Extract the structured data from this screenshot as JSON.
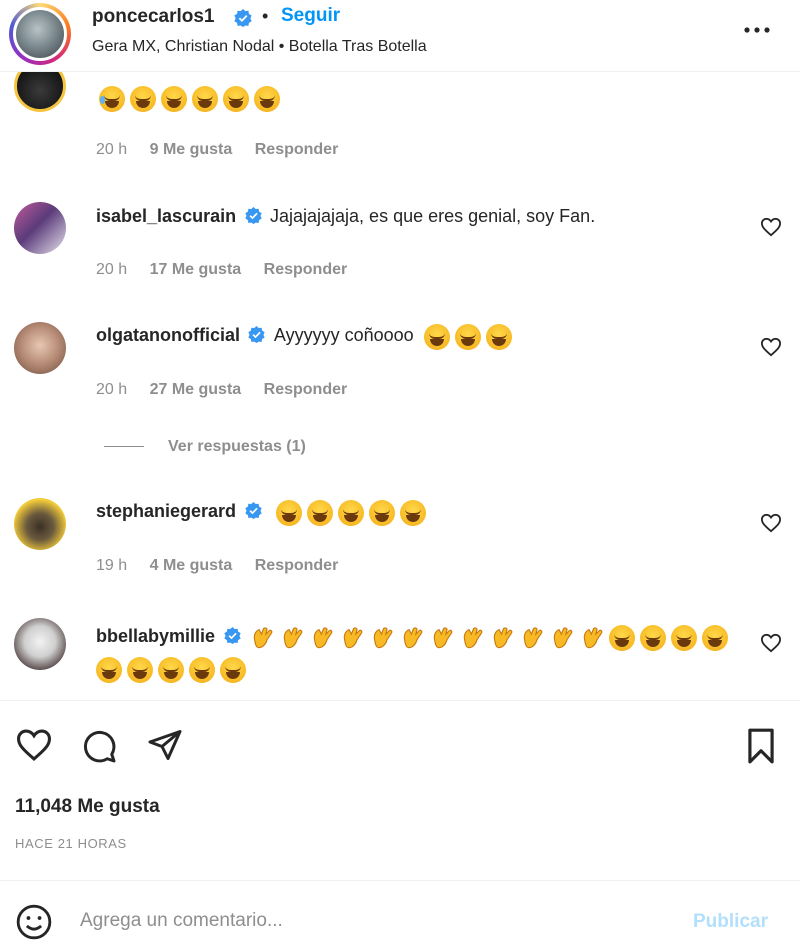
{
  "header": {
    "username": "poncecarlos1",
    "separator": "•",
    "follow_label": "Seguir",
    "subtitle": "Gera MX, Christian Nodal • Botella Tras Botella"
  },
  "comments": [
    {
      "time": "20 h",
      "likes": "9 Me gusta",
      "reply": "Responder",
      "emoji_count": 6
    },
    {
      "username": "isabel_lascurain",
      "text": "Jajajajajaja, es que eres genial, soy Fan.",
      "time": "20 h",
      "likes": "17 Me gusta",
      "reply": "Responder"
    },
    {
      "username": "olgatanonofficial",
      "text": "Ayyyyyy coñoooo",
      "time": "20 h",
      "likes": "27 Me gusta",
      "reply": "Responder",
      "view_replies": "Ver respuestas (1)"
    },
    {
      "username": "stephaniegerard",
      "time": "19 h",
      "likes": "4 Me gusta",
      "reply": "Responder"
    },
    {
      "username": "bbellabymillie"
    }
  ],
  "post": {
    "likes": "11,048 Me gusta",
    "timestamp": "HACE 21 HORAS"
  },
  "comment_box": {
    "placeholder": "Agrega un comentario...",
    "publish_label": "Publicar"
  },
  "colors": {
    "accent": "#0095f6",
    "verified": "#3897f0",
    "publish_disabled": "#b2dffc",
    "muted": "#8e8e8e"
  }
}
